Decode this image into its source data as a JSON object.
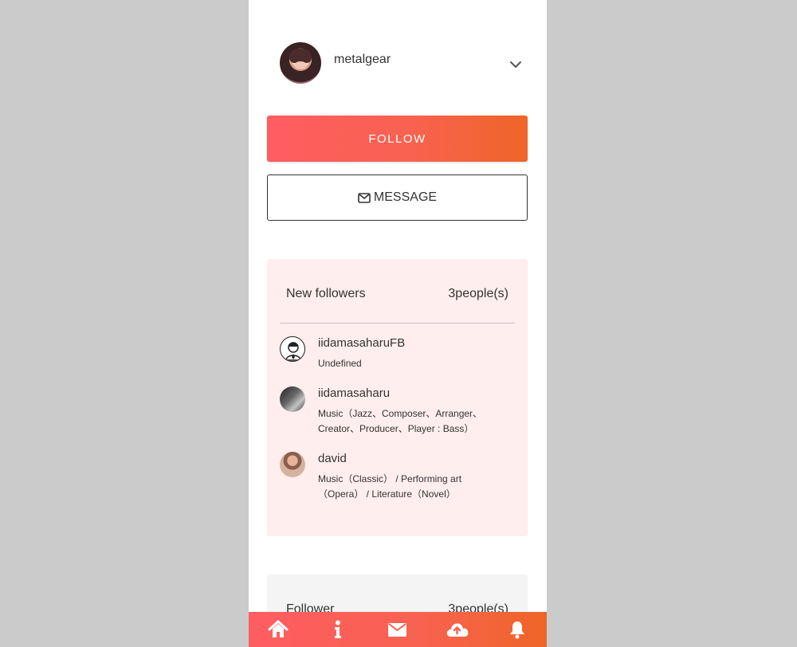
{
  "profile": {
    "username": "metalgear"
  },
  "buttons": {
    "follow": "FOLLOW",
    "message": "MESSAGE"
  },
  "new_followers": {
    "title": "New followers",
    "count": "3people(s)",
    "items": [
      {
        "name": "iidamasaharuFB",
        "desc": "Undefined"
      },
      {
        "name": "iidamasaharu",
        "desc": "Music（Jazz、Composer、Arranger、Creator、Producer、Player : Bass）"
      },
      {
        "name": "david",
        "desc": "Music（Classic） / Performing art（Opera） / Literature（Novel）"
      }
    ]
  },
  "followers": {
    "title": "Follower",
    "count": "3people(s)"
  },
  "nav": {
    "items": [
      "home-icon",
      "info-icon",
      "mail-icon",
      "upload-icon",
      "bell-icon"
    ]
  },
  "colors": {
    "accent_start": "#ff5d62",
    "accent_end": "#ef6528",
    "new_followers_bg": "#ffeeed",
    "page_bg": "#cbcbcb"
  }
}
